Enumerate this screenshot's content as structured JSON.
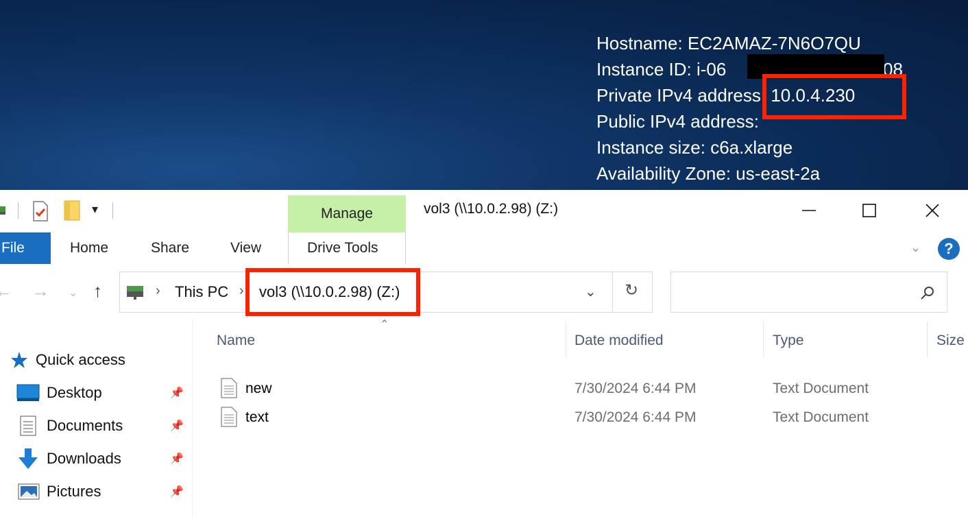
{
  "bginfo": {
    "hostname": "Hostname: EC2AMAZ-7N6O7QU",
    "instance_id": "Instance ID: i-06",
    "instance_id_tail": "08",
    "private_ip_label": "Private IPv4 address: ",
    "private_ip": "10.0.4.230",
    "public_ip": "Public IPv4 address:",
    "instance_size": "Instance size: c6a.xlarge",
    "availability_zone": "Availability Zone: us-east-2a"
  },
  "window": {
    "title": "vol3 (\\\\10.0.2.98) (Z:)",
    "context_tab": "Manage",
    "context_group": "Drive Tools"
  },
  "ribbon": {
    "tabs": [
      "File",
      "Home",
      "Share",
      "View",
      "Drive Tools"
    ]
  },
  "address": {
    "crumbs": [
      "This PC",
      "vol3 (\\\\10.0.2.98) (Z:)"
    ]
  },
  "search": {
    "placeholder": ""
  },
  "navpane": {
    "items": [
      {
        "label": "Quick access",
        "icon": "star-icon"
      },
      {
        "label": "Desktop",
        "icon": "desktop-icon",
        "pinned": true
      },
      {
        "label": "Documents",
        "icon": "documents-icon",
        "pinned": true
      },
      {
        "label": "Downloads",
        "icon": "download-arrow-icon",
        "pinned": true
      },
      {
        "label": "Pictures",
        "icon": "pictures-icon",
        "pinned": true
      }
    ]
  },
  "columns": [
    "Name",
    "Date modified",
    "Type",
    "Size"
  ],
  "files": [
    {
      "name": "new",
      "date": "7/30/2024 6:44 PM",
      "type": "Text Document"
    },
    {
      "name": "text",
      "date": "7/30/2024 6:44 PM",
      "type": "Text Document"
    }
  ],
  "colors": {
    "accent": "#1a6ec2",
    "highlight": "#ff2200",
    "manage_tab": "#c6efa8"
  }
}
